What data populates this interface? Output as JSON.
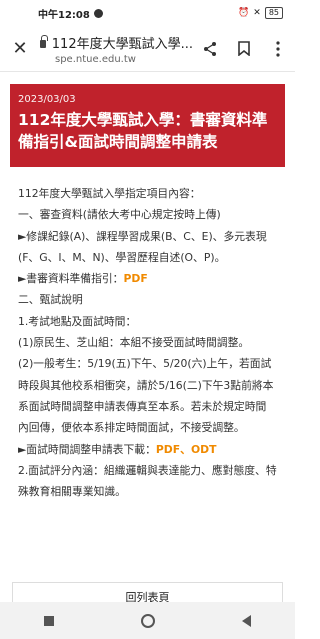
{
  "status": {
    "time": "中午12:08",
    "battery": "85"
  },
  "browser": {
    "page_title": "112年度大學甄試入學...",
    "host": "spe.ntue.edu.tw"
  },
  "banner": {
    "date": "2023/03/03",
    "title": "112年度大學甄試入學：書審資料準備指引&面試時間調整申請表"
  },
  "article": {
    "line1": "112年度大學甄試入學指定項目內容：",
    "line2": "一、審查資料(請依大考中心規定按時上傳)",
    "line3": "►修課紀錄(A)、課程學習成果(B、C、E)、多元表現(F、G、I、M、N)、學習歷程自述(O、P)。",
    "line4_prefix": "►書審資料準備指引：",
    "line4_link": "PDF",
    "line5": "二、甄試說明",
    "line6": "1.考試地點及面試時間：",
    "line7": "(1)原民生、芝山組：本組不接受面試時間調整。",
    "line8": "(2)一般考生：5/19(五)下午、5/20(六)上午，若面試時段與其他校系相衝突，請於5/16(二)下午3點前將本系面試時間調整申請表傳真至本系。若未於規定時間內回傳，便依本系排定時間面試，不接受調整。",
    "line9_prefix": "►面試時間調整申請表下載：",
    "line9_link1": "PDF",
    "line9_sep": "、",
    "line9_link2": "ODT",
    "line10": "2.面試評分內涵：組織邏輯與表達能力、應對態度、特殊教育相關專業知識。"
  },
  "footer": {
    "back_button": "回列表頁"
  }
}
